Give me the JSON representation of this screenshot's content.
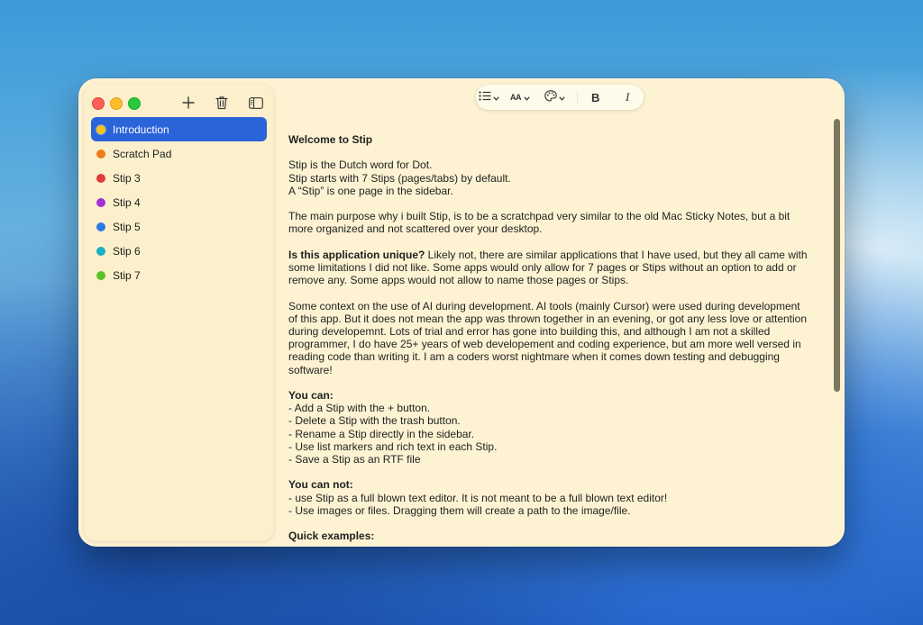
{
  "window": {
    "background": "#fdf3d3",
    "accent": "#2b63d9"
  },
  "sidebar": {
    "toolbar_icons": [
      "plus-icon",
      "trash-icon",
      "sidebar-toggle-icon"
    ],
    "items": [
      {
        "label": "Introduction",
        "color": "#f5c518",
        "selected": true
      },
      {
        "label": "Scratch Pad",
        "color": "#f07a1a",
        "selected": false
      },
      {
        "label": "Stip 3",
        "color": "#e03a3a",
        "selected": false
      },
      {
        "label": "Stip 4",
        "color": "#a22fd1",
        "selected": false
      },
      {
        "label": "Stip 5",
        "color": "#2a7ae2",
        "selected": false
      },
      {
        "label": "Stip 6",
        "color": "#1bb0c4",
        "selected": false
      },
      {
        "label": "Stip 7",
        "color": "#5cc02a",
        "selected": false
      }
    ]
  },
  "format_toolbar": {
    "list_icon": "list-icon",
    "text_size_label": "AA",
    "color_icon": "palette-icon",
    "bold_label": "B",
    "italic_label": "I"
  },
  "editor": {
    "title": "Welcome to Stip",
    "intro_1": "Stip is the Dutch word for Dot.",
    "intro_2": "Stip starts with 7 Stips (pages/tabs) by default.",
    "intro_3": "A “Stip” is one page in the sidebar.",
    "purpose": "The main purpose why i built Stip, is to be a scratchpad very similar to the old Mac Sticky Notes, but a bit more organized and not scattered over your desktop.",
    "unique_q": "Is this application unique?",
    "unique_a": " Likely not, there are similar applications that I have used, but they all came with some limitations I did not like. Some apps would only allow for 7 pages or Stips without an option to add or remove any. Some apps would not allow to name those pages or Stips.",
    "ai_context": "Some context on the use of AI during development. AI tools (mainly Cursor) were used during development of this app. But it does not mean the app was thrown together in an evening, or got any less love or attention during developemnt. Lots of trial and error has gone into building this, and although I am not a skilled programmer, I do have 25+ years of web developement and coding experience, but am more well versed in reading code than writing it. I am a coders worst nightmare when it comes down testing and debugging software!",
    "can_heading": "You can:",
    "can_items": [
      "- Add a Stip with the + button.",
      "- Delete a Stip with the trash button.",
      "- Rename a Stip directly in the sidebar.",
      "- Use list markers and rich text in each Stip.",
      "- Save a Stip as an RTF file"
    ],
    "cannot_heading": "You can not:",
    "cannot_items": [
      "- use Stip as a full blown text editor. It is not meant to be a full blown text editor!",
      "- Use images or files. Dragging them will create a path to the image/file."
    ],
    "examples_heading": "Quick examples:"
  }
}
